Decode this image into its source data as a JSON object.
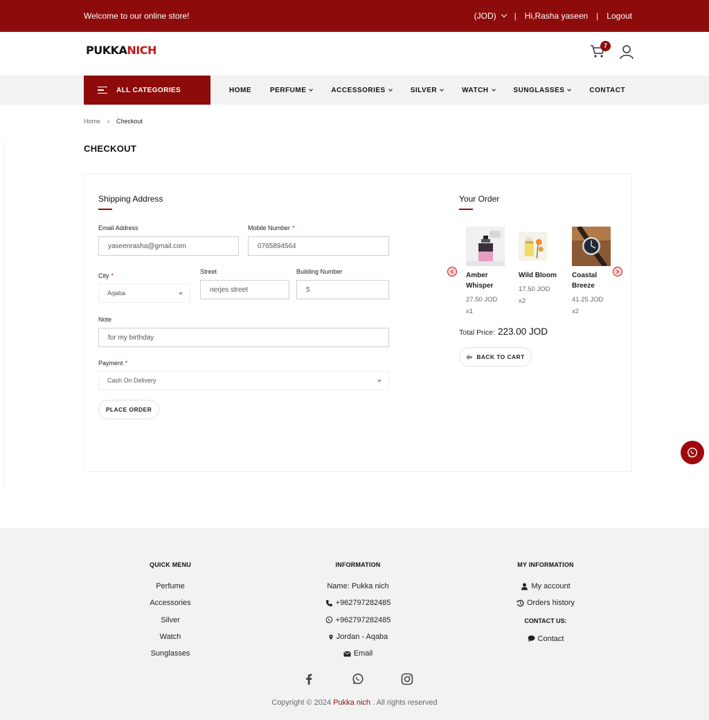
{
  "topbar": {
    "welcome": "Welcome to our online store!",
    "currency": "(JOD)",
    "greeting": "Hi,Rasha yaseen",
    "logout": "Logout",
    "separator": "|"
  },
  "header": {
    "logo_part1": "PUKKA",
    "logo_part2": "NICH",
    "cart_count": "7",
    "icons": [
      "cart-icon",
      "user-icon"
    ]
  },
  "nav": {
    "all_categories": "ALL CATEGORIES",
    "items": [
      "HOME",
      "PERFUME",
      "ACCESSORIES",
      "SILVER",
      "WATCH",
      "SUNGLASSES",
      "CONTACT"
    ]
  },
  "breadcrumb": {
    "home": "Home",
    "separator": "»",
    "current": "Checkout"
  },
  "page_title": "CHECKOUT",
  "shipping": {
    "title": "Shipping Address",
    "email_label": "Email Address",
    "email_value": "yaseenrasha@gmail.com",
    "mobile_label": "Mobile Number",
    "mobile_value": "0765894564",
    "city_label": "City",
    "city_value": "Aqaba",
    "street_label": "Street",
    "street_value": "nerjes street",
    "building_label": "Building Number",
    "building_value": "5",
    "note_label": "Note",
    "note_value": "for my birthday",
    "payment_label": "Payment",
    "payment_value": "Cash On Delivery",
    "required_mark": "*",
    "place_order": "PLACE ORDER"
  },
  "order": {
    "title": "Your Order",
    "products": [
      {
        "name": "Amber Whisper",
        "price": "27.50 JOD",
        "qty": "x1"
      },
      {
        "name": "Wild Bloom",
        "price": "17.50 JOD",
        "qty": "x2"
      },
      {
        "name": "Coastal Breeze",
        "price": "41.25 JOD",
        "qty": "x2"
      }
    ],
    "total_label": "Total Price:",
    "total_value": "223.00 JOD",
    "back_to_cart": "BACK TO CART"
  },
  "footer": {
    "quick_menu": {
      "title": "QUICK MENU",
      "items": [
        "Perfume",
        "Accessories",
        "Silver",
        "Watch",
        "Sunglasses"
      ]
    },
    "information": {
      "title": "INFORMATION",
      "name": "Name: Pukka nich",
      "phone": "+962797282485",
      "whatsapp": "+962797282485",
      "location": "Jordan - Aqaba",
      "email": "Email"
    },
    "my_information": {
      "title": "MY INFORMATION",
      "account": "My account",
      "orders": "Orders history",
      "contact_title": "CONTACT US:",
      "contact": "Contact"
    },
    "copyright_prefix": "Copyright © 2024",
    "copyright_brand": "Pukka nich",
    "copyright_suffix": ". All rights reserved"
  },
  "colors": {
    "brand": "#8e0b0b",
    "accent_red": "#c8171b",
    "footer_bg": "#f2f2f2"
  }
}
